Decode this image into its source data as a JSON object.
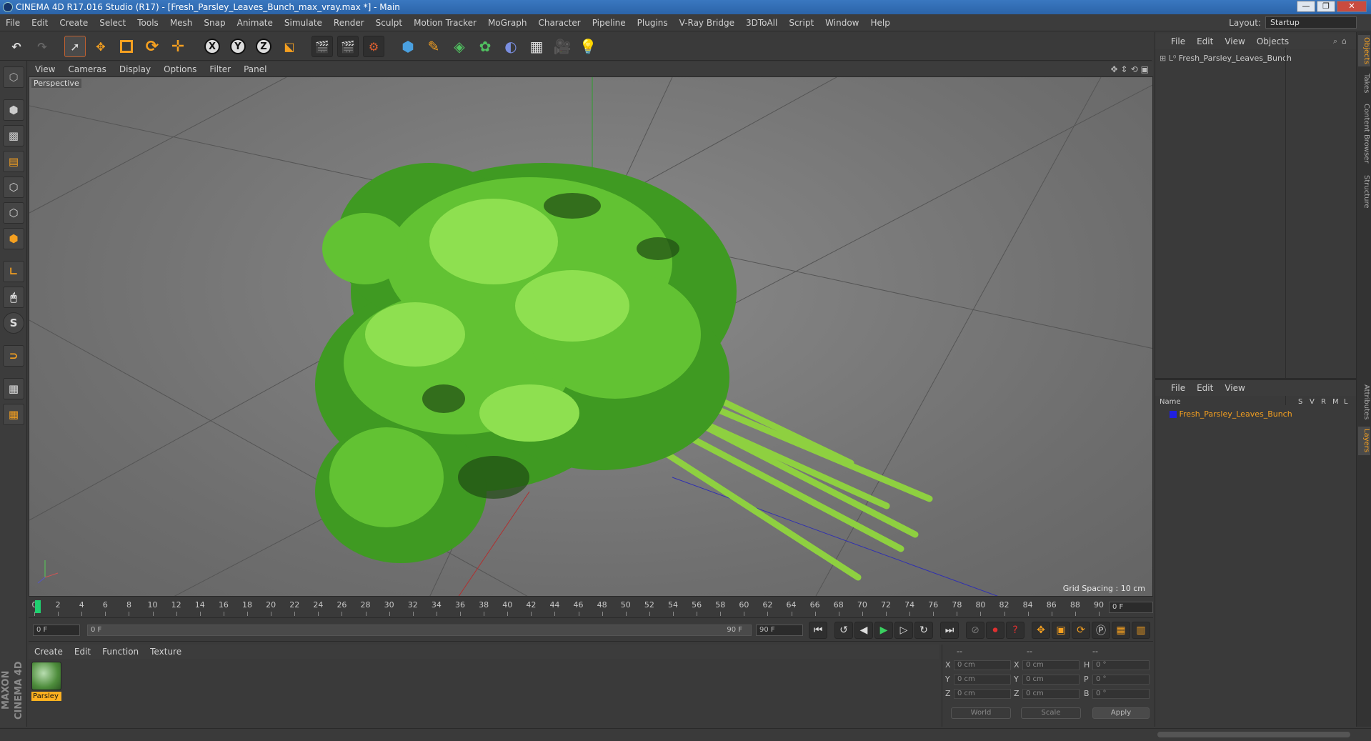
{
  "window": {
    "title": "CINEMA 4D R17.016 Studio (R17) - [Fresh_Parsley_Leaves_Bunch_max_vray.max *] - Main",
    "min": "—",
    "max": "❐",
    "close": "✕"
  },
  "menubar": {
    "items": [
      "File",
      "Edit",
      "Create",
      "Select",
      "Tools",
      "Mesh",
      "Snap",
      "Animate",
      "Simulate",
      "Render",
      "Sculpt",
      "Motion Tracker",
      "MoGraph",
      "Character",
      "Pipeline",
      "Plugins",
      "V-Ray Bridge",
      "3DToAll",
      "Script",
      "Window",
      "Help"
    ],
    "layout_label": "Layout:",
    "layout_value": "Startup"
  },
  "toolbar": {
    "x_axis": "X",
    "y_axis": "Y",
    "z_axis": "Z"
  },
  "viewport": {
    "menu": [
      "View",
      "Cameras",
      "Display",
      "Options",
      "Filter",
      "Panel"
    ],
    "label": "Perspective",
    "grid_spacing": "Grid Spacing : 10 cm"
  },
  "timeline": {
    "ticks": [
      "0",
      "2",
      "4",
      "6",
      "8",
      "10",
      "12",
      "14",
      "16",
      "18",
      "20",
      "22",
      "24",
      "26",
      "28",
      "30",
      "32",
      "34",
      "36",
      "38",
      "40",
      "42",
      "44",
      "46",
      "48",
      "50",
      "52",
      "54",
      "56",
      "58",
      "60",
      "62",
      "64",
      "66",
      "68",
      "70",
      "72",
      "74",
      "76",
      "78",
      "80",
      "82",
      "84",
      "86",
      "88",
      "90"
    ],
    "current_frame": "0 F"
  },
  "playbar": {
    "start": "0 F",
    "range_start": "0 F",
    "range_end": "90 F",
    "end": "90 F"
  },
  "materials": {
    "menu": [
      "Create",
      "Edit",
      "Function",
      "Texture"
    ],
    "items": [
      {
        "name": "Parsley"
      }
    ]
  },
  "coords": {
    "header": [
      "--",
      "--",
      "--"
    ],
    "rows": [
      {
        "a": "X",
        "av": "0 cm",
        "b": "X",
        "bv": "0 cm",
        "c": "H",
        "cv": "0 °"
      },
      {
        "a": "Y",
        "av": "0 cm",
        "b": "Y",
        "bv": "0 cm",
        "c": "P",
        "cv": "0 °"
      },
      {
        "a": "Z",
        "av": "0 cm",
        "b": "Z",
        "bv": "0 cm",
        "c": "B",
        "cv": "0 °"
      }
    ],
    "world": "World",
    "scale": "Scale",
    "apply": "Apply"
  },
  "objects_panel": {
    "menu": [
      "File",
      "Edit",
      "View",
      "Objects"
    ],
    "object": "Fresh_Parsley_Leaves_Bunch"
  },
  "layers_panel": {
    "menu": [
      "File",
      "Edit",
      "View"
    ],
    "col_name": "Name",
    "cols": [
      "S",
      "V",
      "R",
      "M",
      "L"
    ],
    "layer": "Fresh_Parsley_Leaves_Bunch",
    "layer_color": "#2020e0"
  },
  "side_tabs": [
    "Objects",
    "Takes",
    "Content Browser",
    "Structure",
    "Attributes",
    "Layers"
  ],
  "brand": "MAXON CINEMA 4D"
}
